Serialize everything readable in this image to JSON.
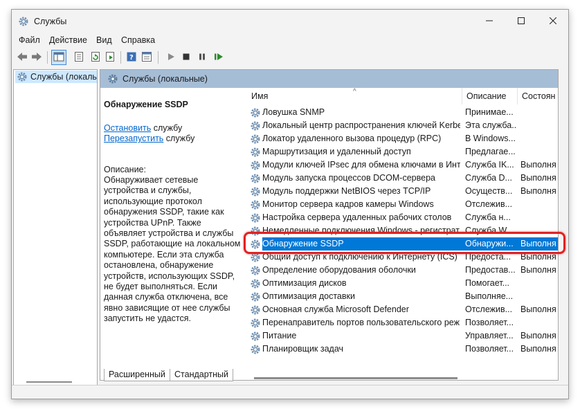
{
  "window": {
    "title": "Службы",
    "icons": {
      "app": "gear-icon",
      "minimize": "minimize-icon",
      "maximize": "maximize-icon",
      "close": "close-icon"
    }
  },
  "menu": [
    "Файл",
    "Действие",
    "Вид",
    "Справка"
  ],
  "toolbar": [
    "back-arrow-icon",
    "forward-arrow-icon",
    "show-hide-console-tree-icon",
    "properties-icon",
    "refresh-icon",
    "export-list-icon",
    "help-icon",
    "console-icon",
    "start-service-icon",
    "stop-service-icon",
    "pause-service-icon",
    "restart-service-icon"
  ],
  "tree": {
    "item_label": "Службы (локальные)"
  },
  "main": {
    "header": "Службы (локальные)",
    "selected_service": "Обнаружение SSDP",
    "actions": [
      {
        "link": "Остановить",
        "suffix": " службу"
      },
      {
        "link": "Перезапустить",
        "suffix": " службу"
      }
    ],
    "description_label": "Описание:",
    "description_text": "Обнаруживает сетевые устройства и службы, использующие протокол обнаружения SSDP, такие как устройства UPnP. Также объявляет устройства и службы SSDP, работающие на локальном компьютере. Если эта служба остановлена, обнаружение устройств, использующих SSDP, не будет выполняться. Если данная служба отключена, все явно зависящие от нее службы запустить не удастся."
  },
  "list": {
    "columns": {
      "name": "Имя",
      "description": "Описание",
      "status": "Состоян"
    },
    "sort_indicator": "^",
    "rows": [
      {
        "name": "Ловушка SNMP",
        "description": "Принимае...",
        "status": ""
      },
      {
        "name": "Локальный центр распространения ключей Kerbe...",
        "description": "Эта служба...",
        "status": ""
      },
      {
        "name": "Локатор удаленного вызова процедур (RPC)",
        "description": "В Windows...",
        "status": ""
      },
      {
        "name": "Маршрутизация и удаленный доступ",
        "description": "Предлагае...",
        "status": ""
      },
      {
        "name": "Модули ключей IPsec для обмена ключами в Инт...",
        "description": "Служба IK...",
        "status": "Выполня"
      },
      {
        "name": "Модуль запуска процессов DCOM-сервера",
        "description": "Служба D...",
        "status": "Выполня"
      },
      {
        "name": "Модуль поддержки NetBIOS через TCP/IP",
        "description": "Осуществ...",
        "status": "Выполня"
      },
      {
        "name": "Монитор сервера кадров камеры Windows",
        "description": "Отслежив...",
        "status": ""
      },
      {
        "name": "Настройка сервера удаленных рабочих столов",
        "description": "Служба н...",
        "status": ""
      },
      {
        "name": "Немедленные подключения Windows - регистрат...",
        "description": "Служба W...",
        "status": ""
      },
      {
        "name": "Обнаружение SSDP",
        "description": "Обнаружи...",
        "status": "Выполня",
        "selected": true
      },
      {
        "name": "Общий доступ к подключению к Интернету (ICS)",
        "description": "Предоста...",
        "status": "Выполня"
      },
      {
        "name": "Определение оборудования оболочки",
        "description": "Предостав...",
        "status": "Выполня"
      },
      {
        "name": "Оптимизация дисков",
        "description": "Помогает...",
        "status": ""
      },
      {
        "name": "Оптимизация доставки",
        "description": "Выполняе...",
        "status": ""
      },
      {
        "name": "Основная служба Microsoft Defender",
        "description": "Отслежив...",
        "status": "Выполня"
      },
      {
        "name": "Перенаправитель портов пользовательского реж...",
        "description": "Позволяет...",
        "status": ""
      },
      {
        "name": "Питание",
        "description": "Управляет...",
        "status": "Выполня"
      },
      {
        "name": "Планировщик задач",
        "description": "Позволяет...",
        "status": "Выполня"
      }
    ]
  },
  "tabs": [
    "Расширенный",
    "Стандартный"
  ],
  "colors": {
    "selection": "#0078d7",
    "header_band": "#a6bdd6",
    "tree_selection": "#cde8ff",
    "annotation": "#e32020"
  }
}
